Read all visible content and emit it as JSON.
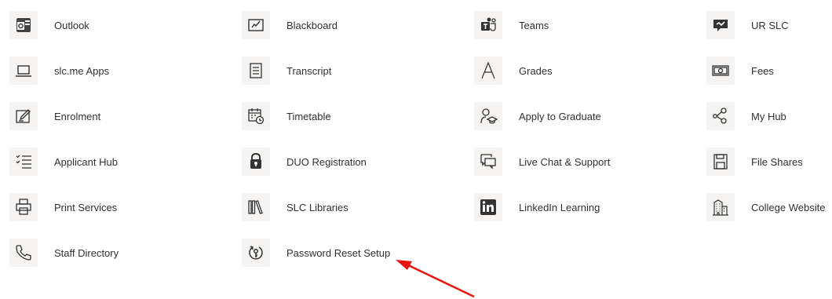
{
  "apps": [
    {
      "label": "Outlook",
      "icon": "outlook-icon"
    },
    {
      "label": "Blackboard",
      "icon": "blackboard-icon"
    },
    {
      "label": "Teams",
      "icon": "teams-icon"
    },
    {
      "label": "UR SLC",
      "icon": "ur-slc-icon"
    },
    {
      "label": "slc.me Apps",
      "icon": "laptop-icon"
    },
    {
      "label": "Transcript",
      "icon": "transcript-icon"
    },
    {
      "label": "Grades",
      "icon": "grades-icon"
    },
    {
      "label": "Fees",
      "icon": "money-icon"
    },
    {
      "label": "Enrolment",
      "icon": "edit-form-icon"
    },
    {
      "label": "Timetable",
      "icon": "calendar-clock-icon"
    },
    {
      "label": "Apply to Graduate",
      "icon": "graduate-icon"
    },
    {
      "label": "My Hub",
      "icon": "hub-icon"
    },
    {
      "label": "Applicant Hub",
      "icon": "checklist-icon"
    },
    {
      "label": "DUO Registration",
      "icon": "lock-icon"
    },
    {
      "label": "Live Chat & Support",
      "icon": "chat-icon"
    },
    {
      "label": "File Shares",
      "icon": "save-icon"
    },
    {
      "label": "Print Services",
      "icon": "printer-icon"
    },
    {
      "label": "SLC Libraries",
      "icon": "library-icon"
    },
    {
      "label": "LinkedIn Learning",
      "icon": "linkedin-icon"
    },
    {
      "label": "College Website",
      "icon": "building-icon"
    },
    {
      "label": "Staff Directory",
      "icon": "phone-icon"
    },
    {
      "label": "Password Reset Setup",
      "icon": "password-reset-icon"
    }
  ],
  "colors": {
    "arrow": "#e8150f",
    "tile_bg": "#f5f4f2",
    "text": "#323130"
  }
}
